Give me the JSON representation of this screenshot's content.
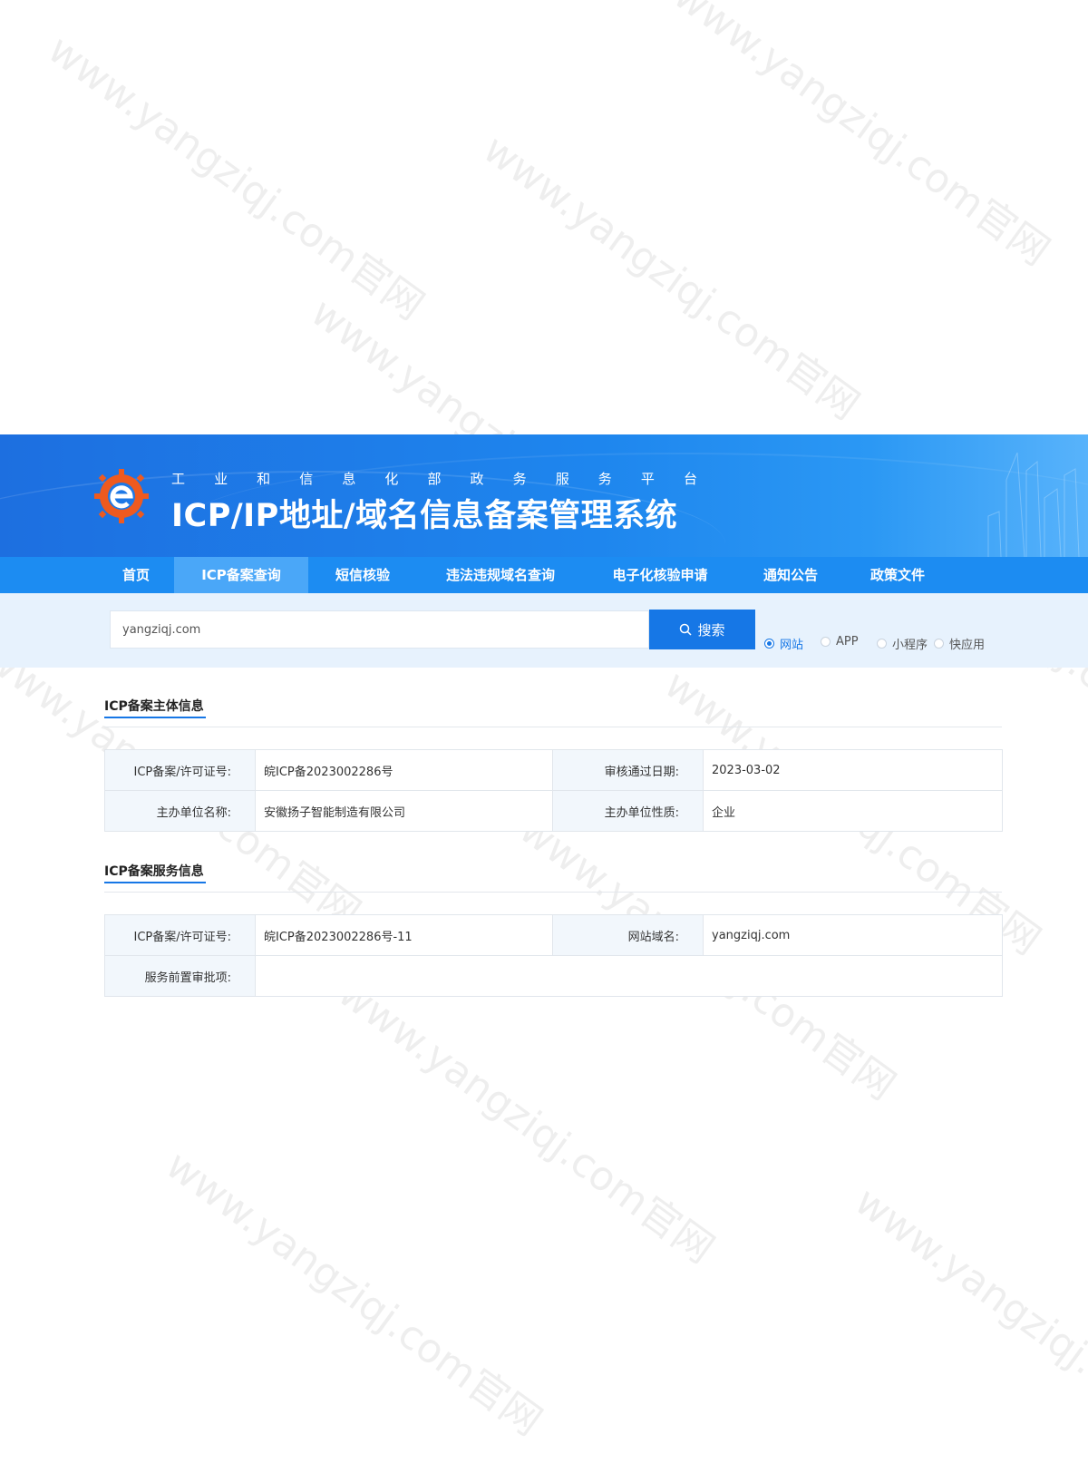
{
  "header": {
    "subtitle_chars": [
      "工",
      "业",
      "和",
      "信",
      "息",
      "化",
      "部",
      "政",
      "务",
      "服",
      "务",
      "平",
      "台"
    ],
    "title": "ICP/IP地址/域名信息备案管理系统"
  },
  "nav": {
    "items": [
      {
        "label": "首页"
      },
      {
        "label": "ICP备案查询"
      },
      {
        "label": "短信核验"
      },
      {
        "label": "违法违规域名查询"
      },
      {
        "label": "电子化核验申请"
      },
      {
        "label": "通知公告"
      },
      {
        "label": "政策文件"
      }
    ],
    "active_index": 1
  },
  "search": {
    "value": "yangziqj.com",
    "button_label": "搜索",
    "radio_options": [
      {
        "label": "网站",
        "checked": true
      },
      {
        "label": "APP",
        "checked": false
      },
      {
        "label": "小程序",
        "checked": false
      },
      {
        "label": "快应用",
        "checked": false
      }
    ]
  },
  "subject_info": {
    "title": "ICP备案主体信息",
    "rows": [
      {
        "label1": "ICP备案/许可证号:",
        "value1": "皖ICP备2023002286号",
        "label2": "审核通过日期:",
        "value2": "2023-03-02"
      },
      {
        "label1": "主办单位名称:",
        "value1": "安徽扬子智能制造有限公司",
        "label2": "主办单位性质:",
        "value2": "企业"
      }
    ]
  },
  "service_info": {
    "title": "ICP备案服务信息",
    "rows": [
      {
        "label1": "ICP备案/许可证号:",
        "value1": "皖ICP备2023002286号-11",
        "label2": "网站域名:",
        "value2": "yangziqj.com"
      },
      {
        "label1": "服务前置审批项:",
        "value1": ""
      }
    ]
  },
  "watermark": {
    "text": "www.yangziqj.com官网"
  },
  "colors": {
    "brand_blue": "#1677e6",
    "nav_blue": "#1c8cf2",
    "nav_active": "#4aa7f8",
    "band_bg": "#e7f2fd",
    "label_bg": "#f2f7fc",
    "logo_orange": "#ee5a1f"
  },
  "icons": {
    "logo": "gear-e-logo-icon",
    "search": "search-icon"
  }
}
